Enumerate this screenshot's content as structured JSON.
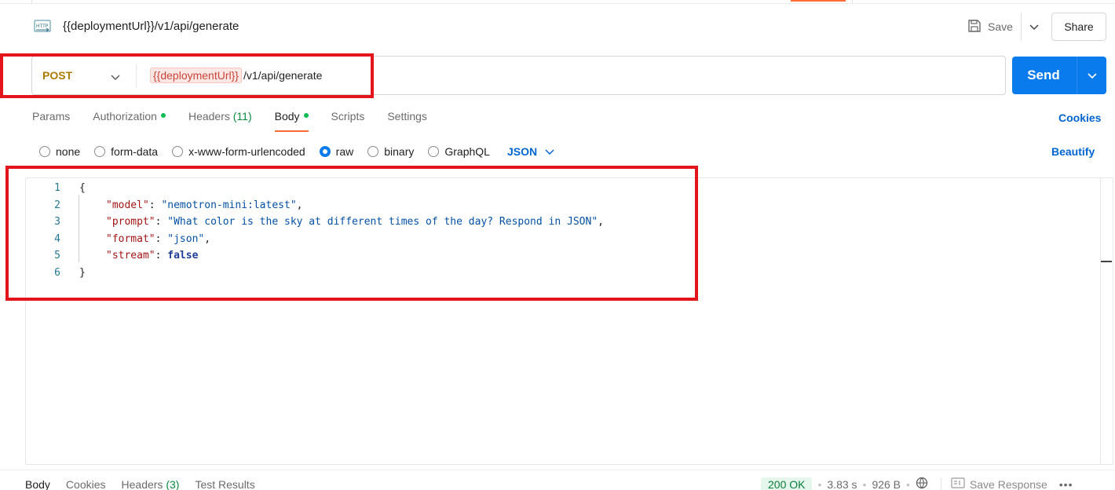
{
  "request": {
    "title": "{{deploymentUrl}}/v1/api/generate",
    "icon": "http-icon",
    "save_label": "Save",
    "share_label": "Share"
  },
  "url_bar": {
    "method": "POST",
    "url_variable": "{{deploymentUrl}}",
    "url_path": "/v1/api/generate",
    "send_label": "Send"
  },
  "tabs": [
    {
      "label": "Params"
    },
    {
      "label": "Authorization",
      "dot": true
    },
    {
      "label": "Headers",
      "count": "(11)"
    },
    {
      "label": "Body",
      "dot": true,
      "active": true
    },
    {
      "label": "Scripts"
    },
    {
      "label": "Settings"
    }
  ],
  "cookies_label": "Cookies",
  "body_types": {
    "options": [
      "none",
      "form-data",
      "x-www-form-urlencoded",
      "raw",
      "binary",
      "GraphQL"
    ],
    "selected": "raw",
    "format": "JSON",
    "beautify_label": "Beautify"
  },
  "editor": {
    "lines": [
      {
        "n": "1",
        "text": "{"
      },
      {
        "n": "2",
        "key": "\"model\"",
        "value": "\"nemotron-mini:latest\"",
        "tail": ","
      },
      {
        "n": "3",
        "key": "\"prompt\"",
        "value": "\"What color is the sky at different times of the day? Respond in JSON\"",
        "tail": ","
      },
      {
        "n": "4",
        "key": "\"format\"",
        "value": "\"json\"",
        "tail": ","
      },
      {
        "n": "5",
        "key": "\"stream\"",
        "value": "false",
        "tail": ""
      },
      {
        "n": "6",
        "text": "}"
      }
    ]
  },
  "response": {
    "tabs": [
      "Body",
      "Cookies",
      "Headers",
      "Test Results"
    ],
    "headers_count": "(3)",
    "status": "200 OK",
    "time": "3.83 s",
    "size": "926 B",
    "save_response_label": "Save Response",
    "more_label": "•••"
  },
  "colors": {
    "send": "#097bed",
    "method": "#ad7a03",
    "highlight": "#e3141b",
    "active_tab_underline": "#ff6c37"
  }
}
